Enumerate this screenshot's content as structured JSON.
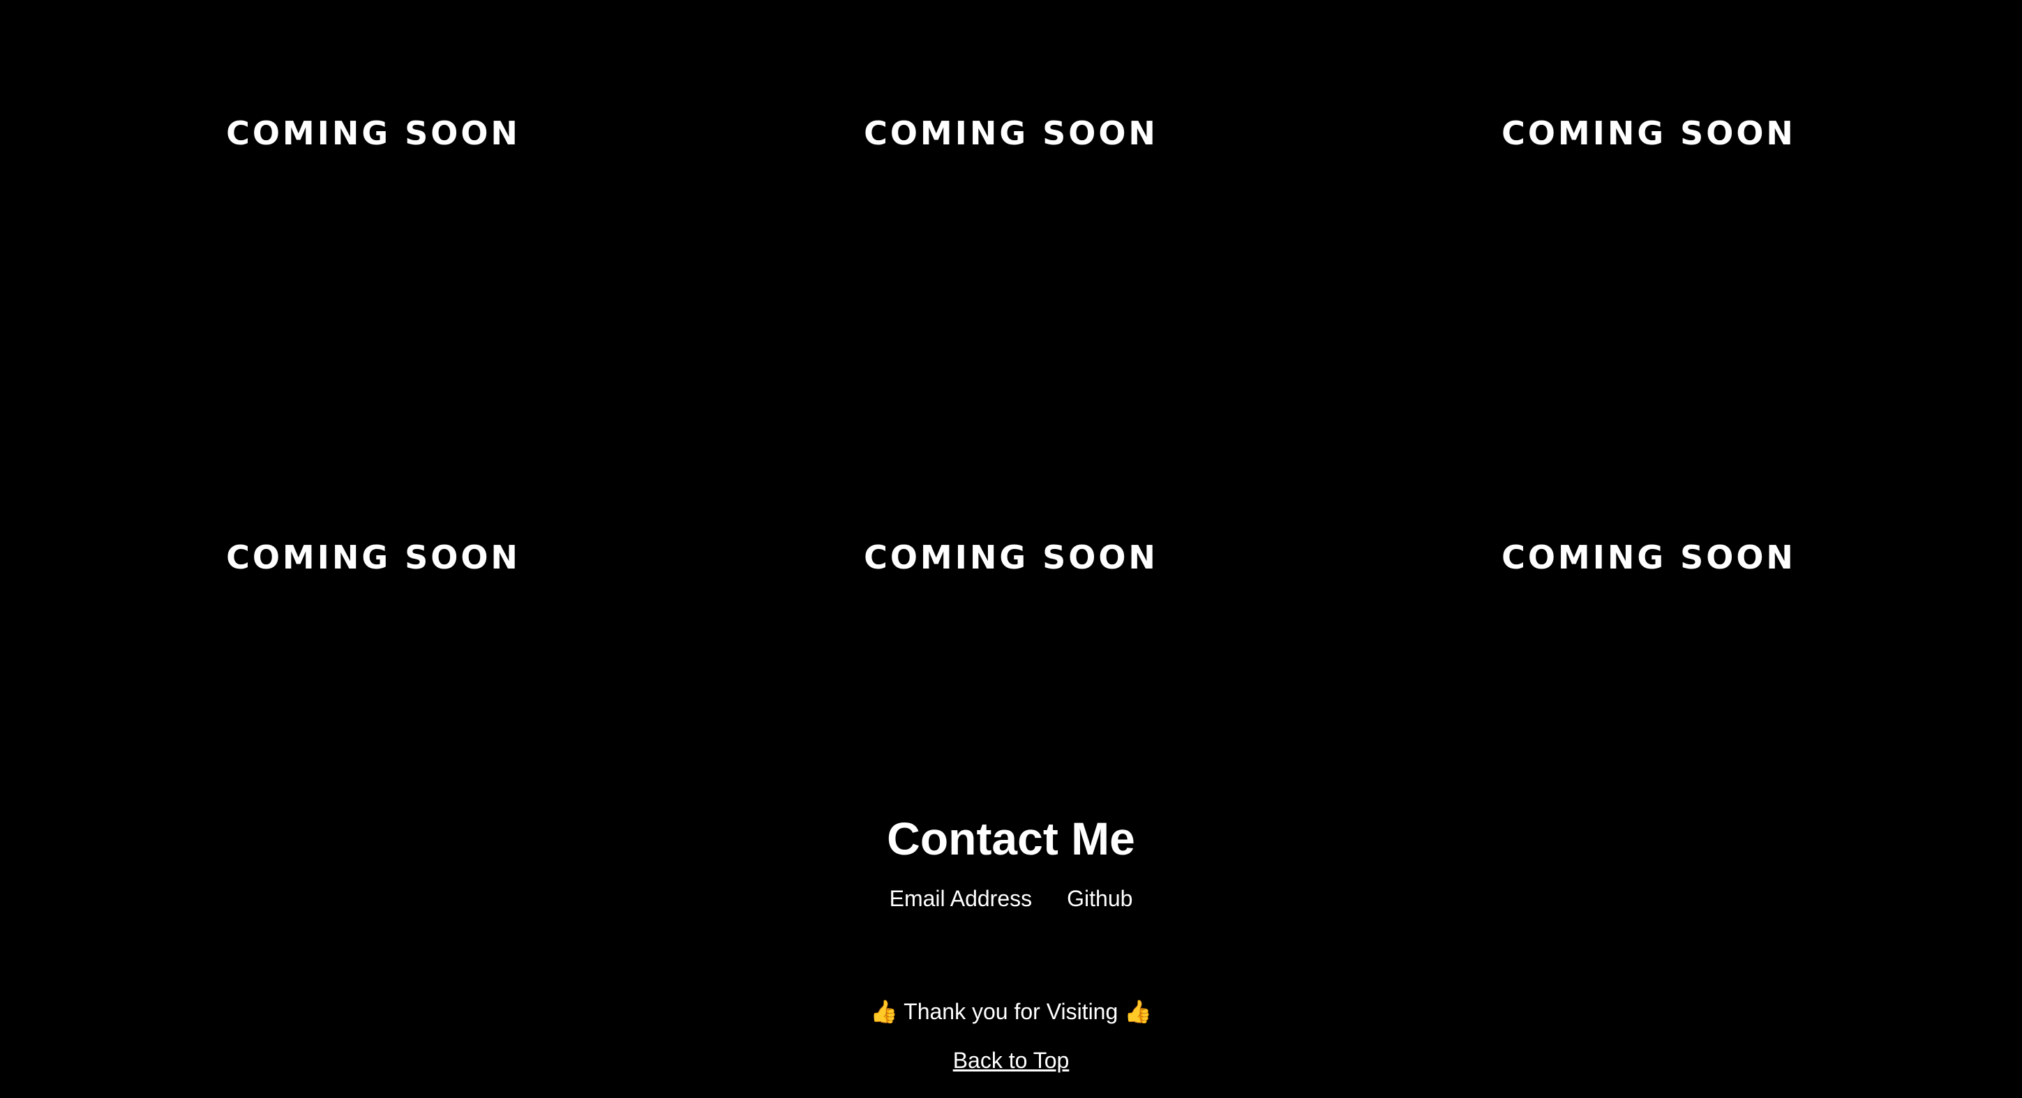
{
  "projects": [
    {
      "label": "COMING SOON"
    },
    {
      "label": "COMING SOON"
    },
    {
      "label": "COMING SOON"
    },
    {
      "label": "COMING SOON"
    },
    {
      "label": "COMING SOON"
    },
    {
      "label": "COMING SOON"
    }
  ],
  "contact": {
    "title": "Contact Me",
    "email_label": "Email Address",
    "github_label": "Github"
  },
  "footer": {
    "thumbs_icon": "👍",
    "thanks_text": "Thank you for Visiting",
    "back_to_top": "Back to Top"
  },
  "colors": {
    "background": "#000000",
    "text": "#ffffff",
    "emoji": "#f2c14e"
  }
}
